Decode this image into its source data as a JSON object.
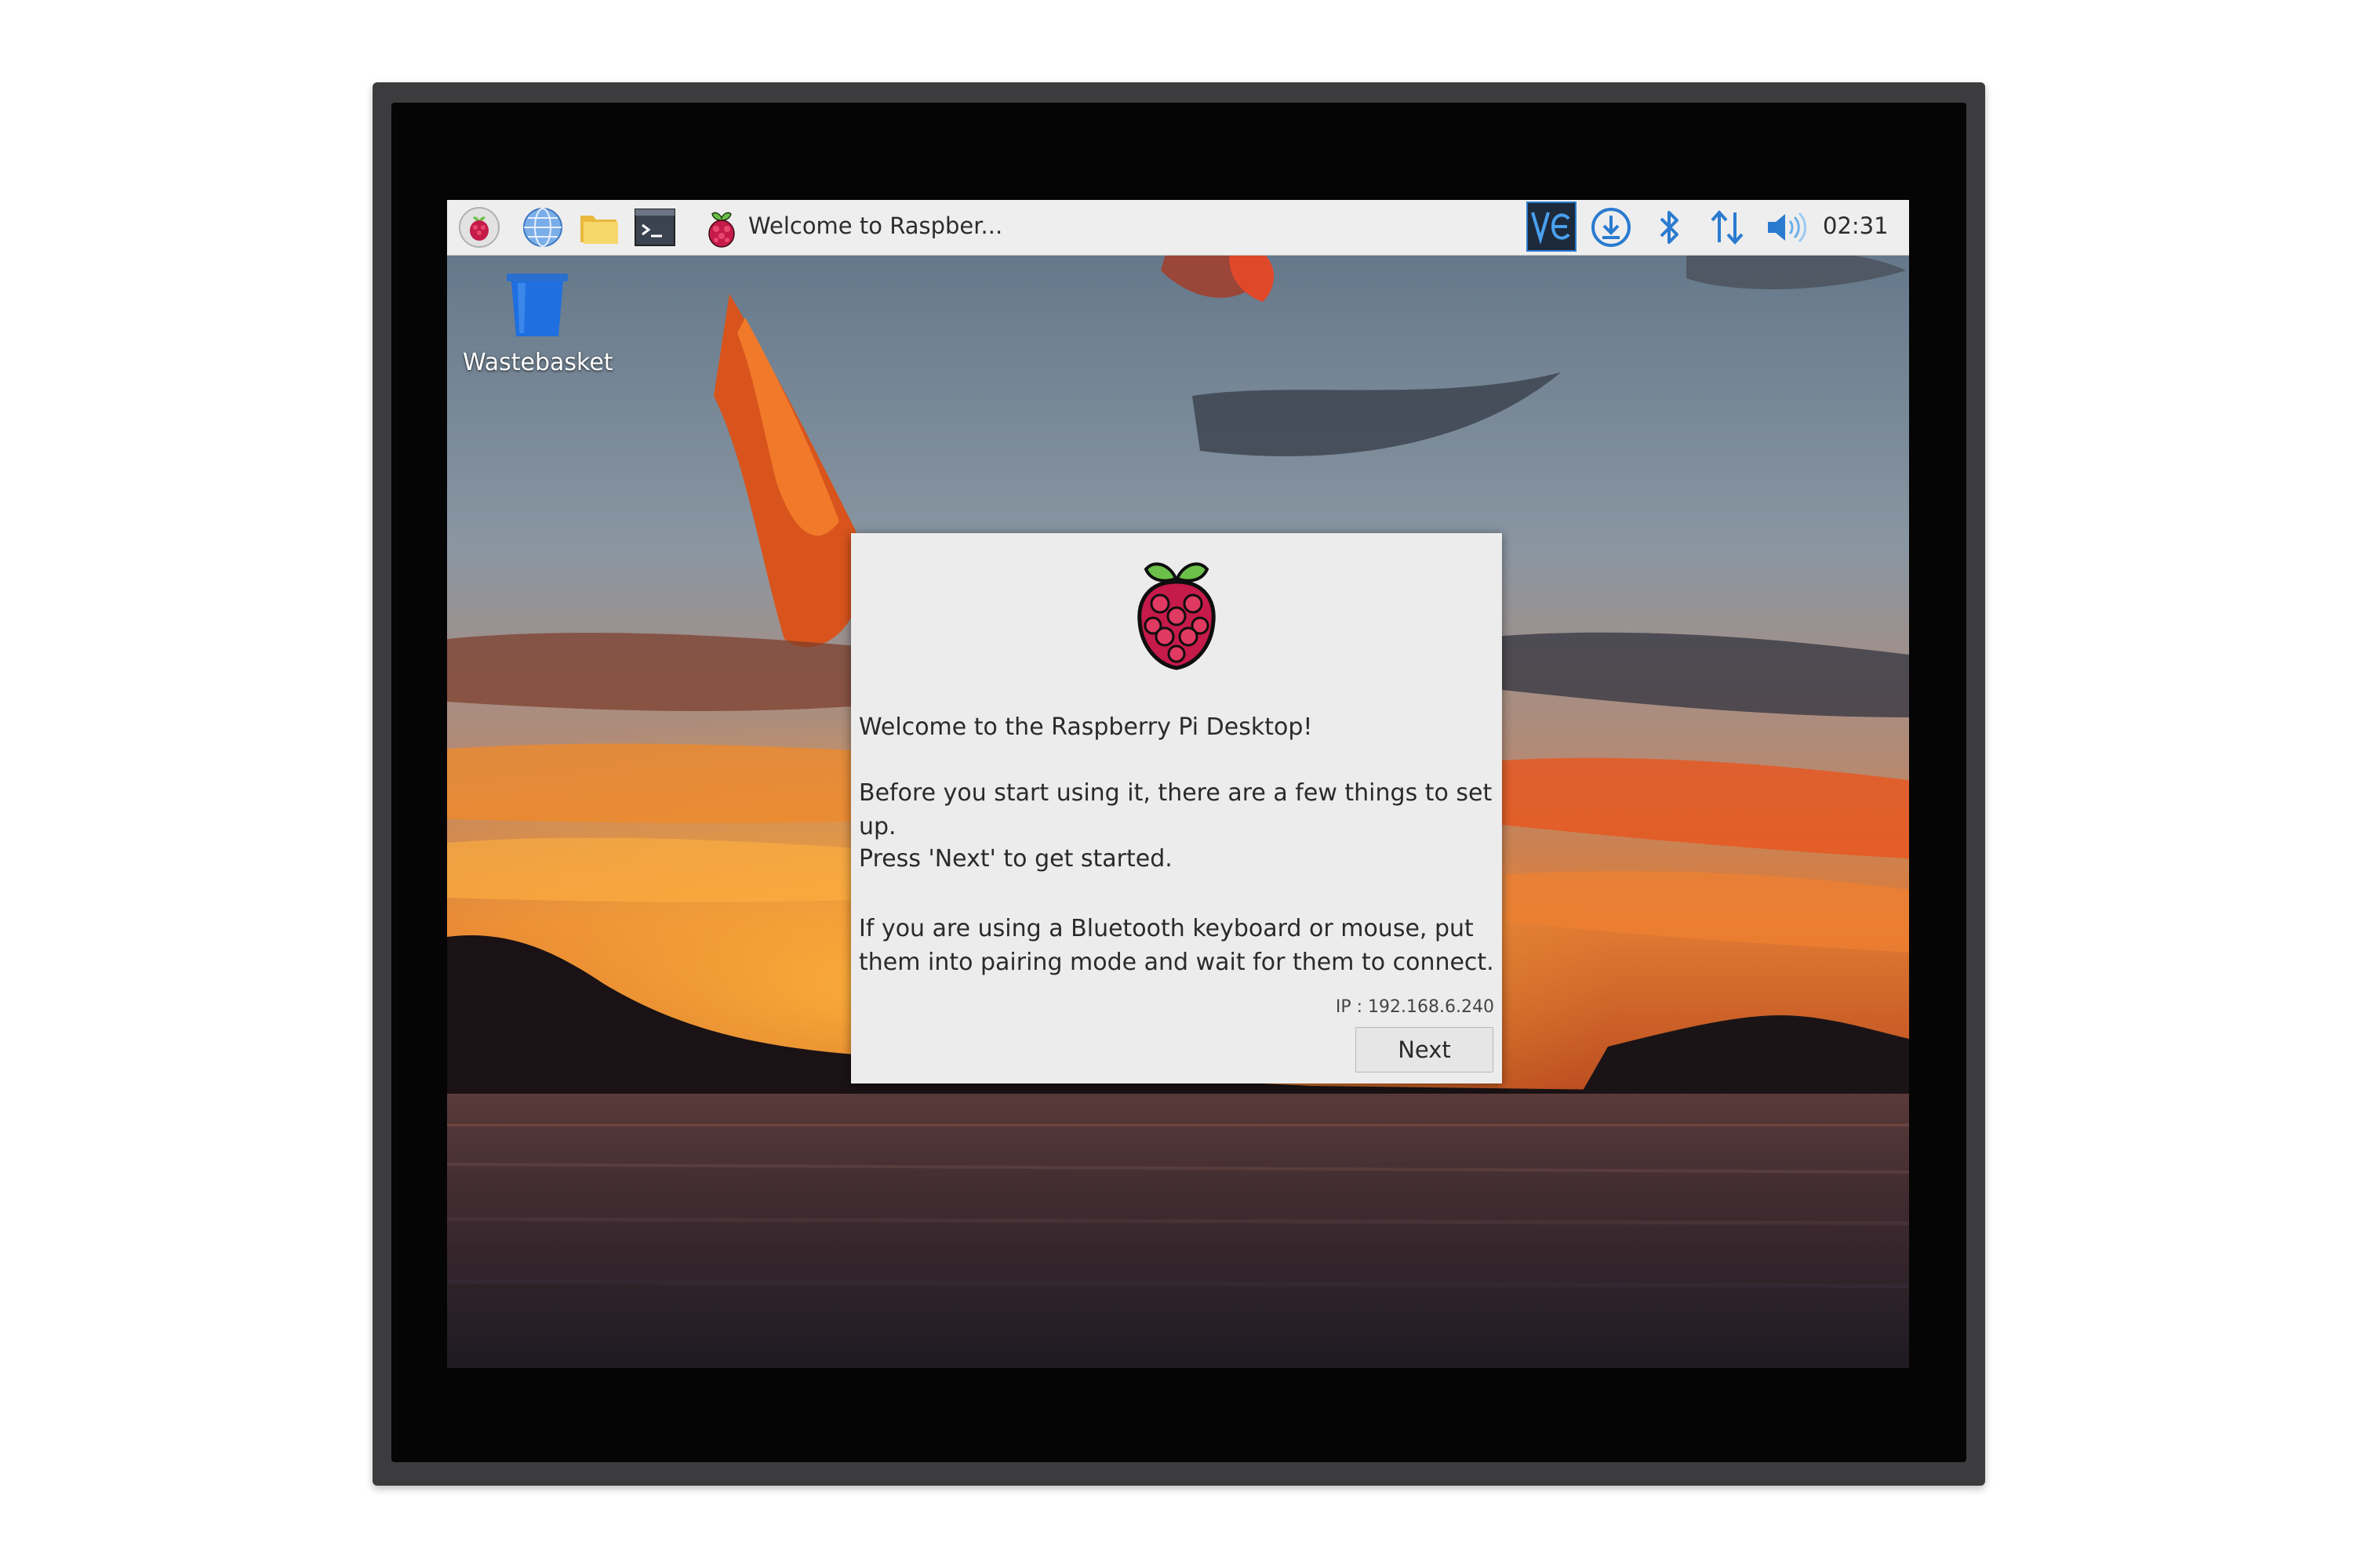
{
  "taskbar": {
    "icons": [
      "raspberry-menu-icon",
      "web-browser-icon",
      "file-manager-icon",
      "terminal-icon"
    ],
    "window_button": {
      "icon": "raspberry-icon",
      "title": "Welcome to Raspber..."
    },
    "tray": [
      "vnc-icon",
      "download-icon",
      "bluetooth-icon",
      "network-icon",
      "volume-icon"
    ],
    "clock": "02:31"
  },
  "desktop": {
    "wastebasket_label": "Wastebasket"
  },
  "dialog": {
    "line1": "Welcome to the Raspberry Pi Desktop!",
    "line2": "Before you start using it, there are a few things to set up.",
    "line3": "Press 'Next' to get started.",
    "line4": "If you are using a Bluetooth keyboard or mouse, put them into pairing mode and wait for them to connect.",
    "ip": "IP : 192.168.6.240",
    "next_label": "Next"
  },
  "colors": {
    "accent": "#2a7bd0",
    "raspberry": "#c51a4a",
    "leaf": "#6cc04a"
  }
}
